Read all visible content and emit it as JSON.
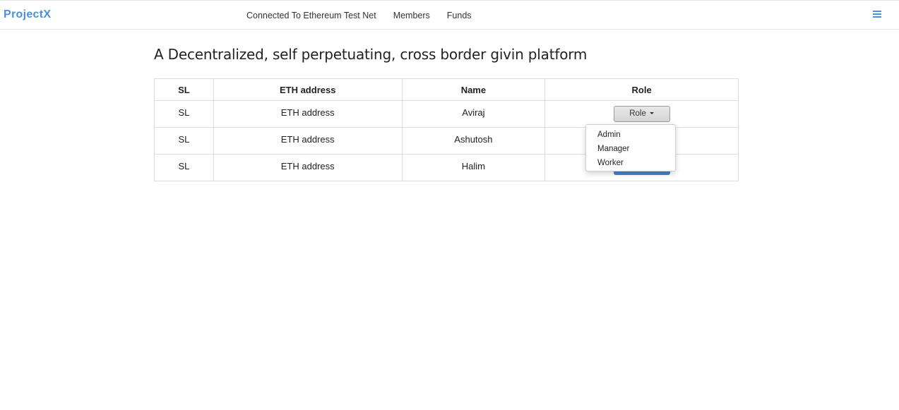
{
  "navbar": {
    "brand": "ProjectX",
    "links": [
      "Connected To Ethereum Test Net",
      "Members",
      "Funds"
    ],
    "menu_icon": "hamburger-icon",
    "accent_color": "#4a90e2"
  },
  "main": {
    "title": "A Decentralized, self perpetuating, cross border givin platform"
  },
  "table": {
    "headers": [
      "SL",
      "ETH address",
      "Name",
      "Role"
    ],
    "rows": [
      {
        "sl": "SL",
        "eth": "ETH address",
        "name": "Aviraj",
        "role_button": "Role"
      },
      {
        "sl": "SL",
        "eth": "ETH address",
        "name": "Ashutosh",
        "role_button": "Role"
      },
      {
        "sl": "SL",
        "eth": "ETH address",
        "name": "Halim",
        "role_button": "Role"
      }
    ]
  },
  "role_dropdown": {
    "open": true,
    "options": [
      "Admin",
      "Manager",
      "Worker"
    ]
  }
}
